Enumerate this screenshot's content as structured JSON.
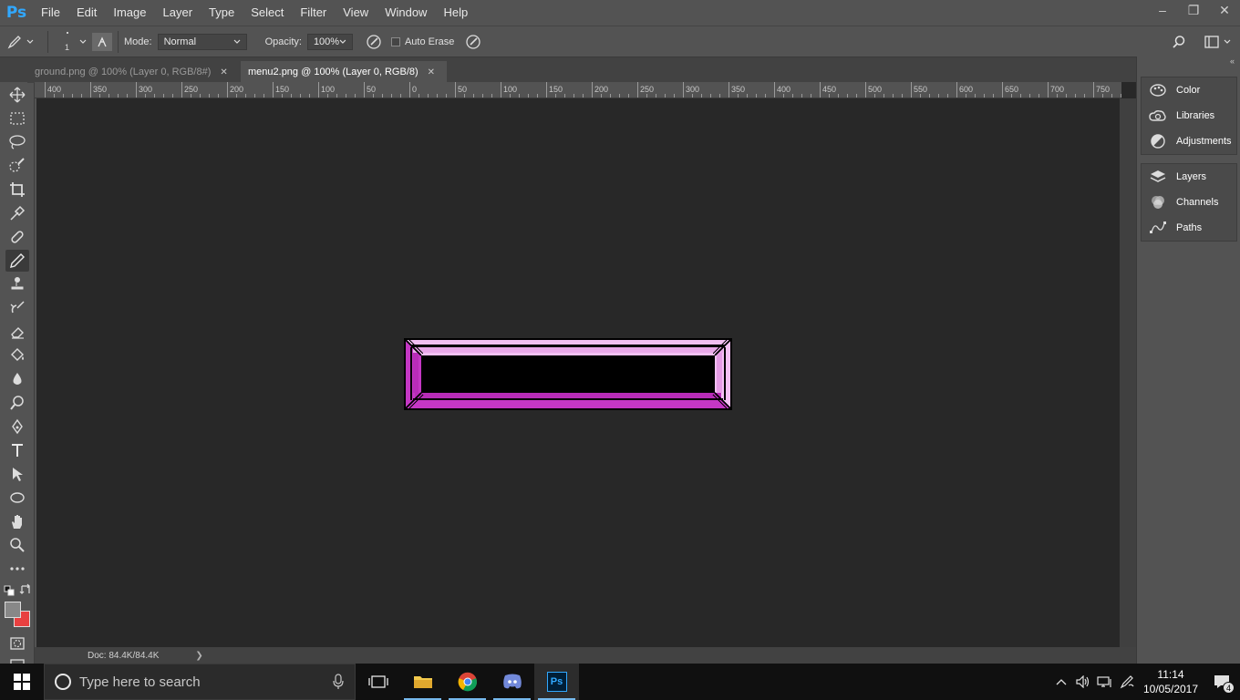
{
  "app": {
    "logo": "Ps"
  },
  "menubar": {
    "items": [
      "File",
      "Edit",
      "Image",
      "Layer",
      "Type",
      "Select",
      "Filter",
      "View",
      "Window",
      "Help"
    ]
  },
  "window_controls": {
    "minimize": "–",
    "restore": "❐",
    "close": "✕"
  },
  "options": {
    "brush_size": "1",
    "mode_label": "Mode:",
    "mode_value": "Normal",
    "opacity_label": "Opacity:",
    "opacity_value": "100%",
    "auto_erase_label": "Auto Erase"
  },
  "tabs": [
    {
      "label": "ground.png @ 100% (Layer 0, RGB/8#)",
      "active": false
    },
    {
      "label": "menu2.png @ 100% (Layer 0, RGB/8)",
      "active": true
    }
  ],
  "ruler": {
    "labels": [
      "400",
      "350",
      "300",
      "250",
      "200",
      "150",
      "100",
      "50",
      "0",
      "50",
      "100",
      "150",
      "200",
      "250",
      "300",
      "350",
      "400",
      "450",
      "500",
      "550",
      "600",
      "650",
      "700",
      "750"
    ]
  },
  "document": {
    "colors": {
      "outline": "#000000",
      "light": "#f3c0f3",
      "mid": "#e59be5",
      "dark": "#c437c4",
      "inner": "#000000"
    }
  },
  "status": {
    "doc_info": "Doc: 84.4K/84.4K"
  },
  "panels": {
    "group1": [
      "Color",
      "Libraries",
      "Adjustments"
    ],
    "group2": [
      "Layers",
      "Channels",
      "Paths"
    ]
  },
  "colors": {
    "foreground": "#888888",
    "background": "#e84040",
    "accent": "#31a8ff"
  },
  "taskbar": {
    "search_placeholder": "Type here to search",
    "time": "11:14",
    "date": "10/05/2017",
    "notification_count": "4"
  }
}
